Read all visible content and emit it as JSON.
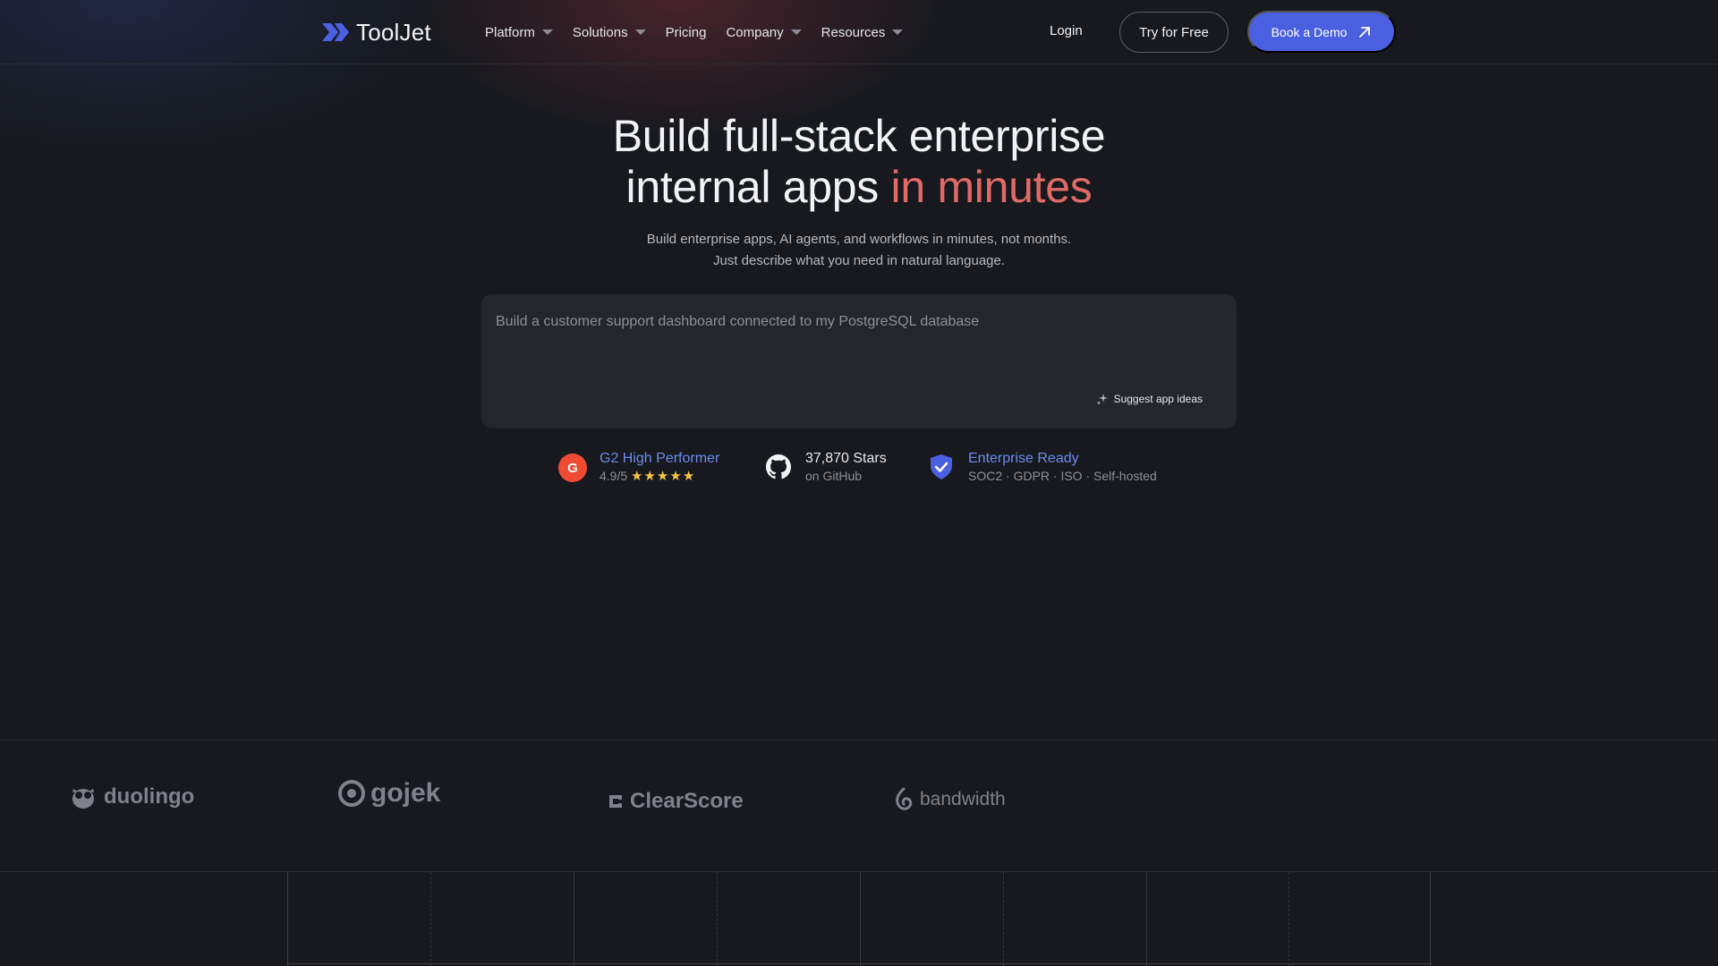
{
  "brand": {
    "name": "ToolJet",
    "logo_color": "#4a60e0"
  },
  "nav": {
    "menu": [
      {
        "label": "Platform",
        "dropdown": true
      },
      {
        "label": "Solutions",
        "dropdown": true
      },
      {
        "label": "Pricing",
        "dropdown": false
      },
      {
        "label": "Company",
        "dropdown": true
      },
      {
        "label": "Resources",
        "dropdown": true
      }
    ],
    "login": "Login",
    "try_free": "Try for Free",
    "book_demo": "Book a Demo"
  },
  "hero": {
    "headline_line1": "Build full-stack enterprise",
    "headline_line2_plain": "internal apps ",
    "headline_line2_accent": "in minutes",
    "accent_color": "#e06a66",
    "subtitle": "Build enterprise apps, AI agents, and workflows in minutes, not months. Just describe what you need in natural language.",
    "prompt_placeholder": "Build a customer support dashboard connected to my PostgreSQL database",
    "prompt_value": "",
    "suggest_label": "Suggest app ideas"
  },
  "badges": {
    "g2": {
      "title": "G2 High Performer",
      "rating": "4.9/5",
      "stars": "★★★★★",
      "icon": "g2-icon"
    },
    "github": {
      "title": "37,870 Stars",
      "sub": "on GitHub",
      "icon": "github-icon"
    },
    "enterprise": {
      "title": "Enterprise Ready",
      "sub": "SOC2 · GDPR · ISO · Self-hosted",
      "icon": "shield-check-icon"
    }
  },
  "customers": [
    {
      "name": "duolingo",
      "icon": "duolingo-owl-icon"
    },
    {
      "name": "gojek",
      "icon": "gojek-icon"
    },
    {
      "name": "ClearScore",
      "icon": "clearscore-icon"
    },
    {
      "name": "bandwidth",
      "icon": "bandwidth-icon"
    }
  ]
}
